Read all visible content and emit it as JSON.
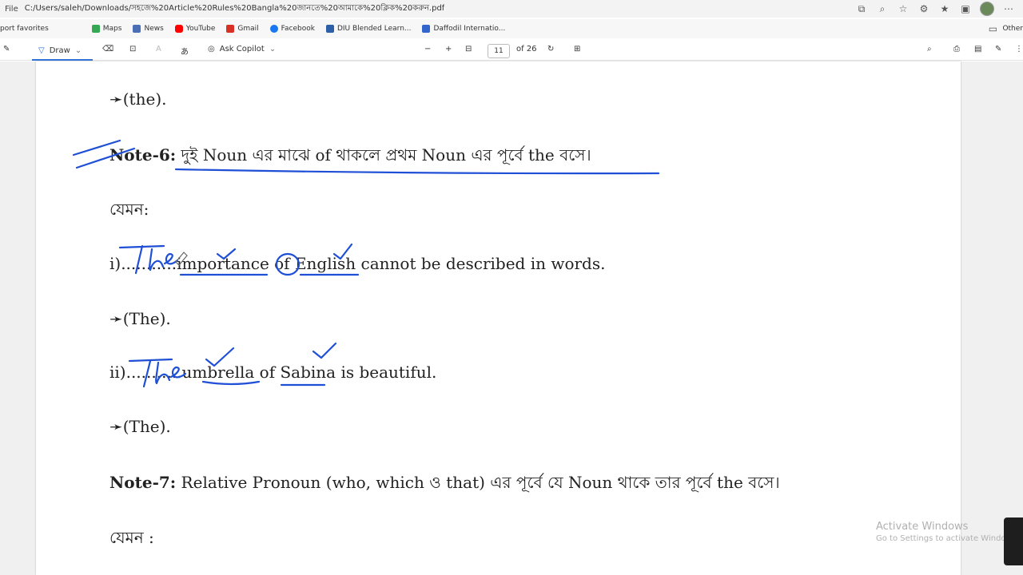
{
  "browser": {
    "file_label": "File",
    "url": "C:/Users/saleh/Downloads/সহজে%20Article%20Rules%20Bangla%20জানতে%20আমাকে%20ক্লিক%20করুন.pdf",
    "bookmarks": [
      {
        "label": "port favorites",
        "icon": "star-icon",
        "color": "#777777"
      },
      {
        "label": "Maps",
        "icon": "maps-icon",
        "color": "#34a853"
      },
      {
        "label": "News",
        "icon": "news-icon",
        "color": "#4a6fb5"
      },
      {
        "label": "YouTube",
        "icon": "youtube-icon",
        "color": "#ff0000"
      },
      {
        "label": "Gmail",
        "icon": "gmail-icon",
        "color": "#d93025"
      },
      {
        "label": "Facebook",
        "icon": "facebook-icon",
        "color": "#1877f2"
      },
      {
        "label": "DIU Blended Learn...",
        "icon": "diu-icon",
        "color": "#2c5fa8"
      },
      {
        "label": "Daffodil Internatio...",
        "icon": "daffodil-icon",
        "color": "#3366cc"
      }
    ],
    "other_bookmarks": "Other"
  },
  "toolbar": {
    "draw_label": "Draw",
    "ask_copilot_label": "Ask Copilot",
    "current_page": "11",
    "total_pages": "of 26"
  },
  "document": {
    "line1": "➛(the).",
    "note6_label": "Note-6:",
    "note6_text": " দুই Noun এর মাঝে of থাকলে প্রথম Noun এর পূর্বে the বসে।",
    "jemon1": "যেমন:",
    "ex1_prefix": "i)...........",
    "ex1_text": "importance of English cannot be described in words.",
    "ans1": "➛(The).",
    "ex2_prefix": "ii)...........",
    "ex2_text": "umbrella of Sabina is beautiful.",
    "ans2": "➛(The).",
    "note7_label": "Note-7:",
    "note7_text": " Relative Pronoun (who, which ও that) এর পূর্বে যে Noun থাকে তার পূর্বে the বসে।",
    "jemon2": "যেমন :"
  },
  "watermark": {
    "title": "Activate Windows",
    "subtitle": "Go to Settings to activate Windows."
  },
  "colors": {
    "ink": "#1f4fd6",
    "accent": "#2e6fd6"
  }
}
